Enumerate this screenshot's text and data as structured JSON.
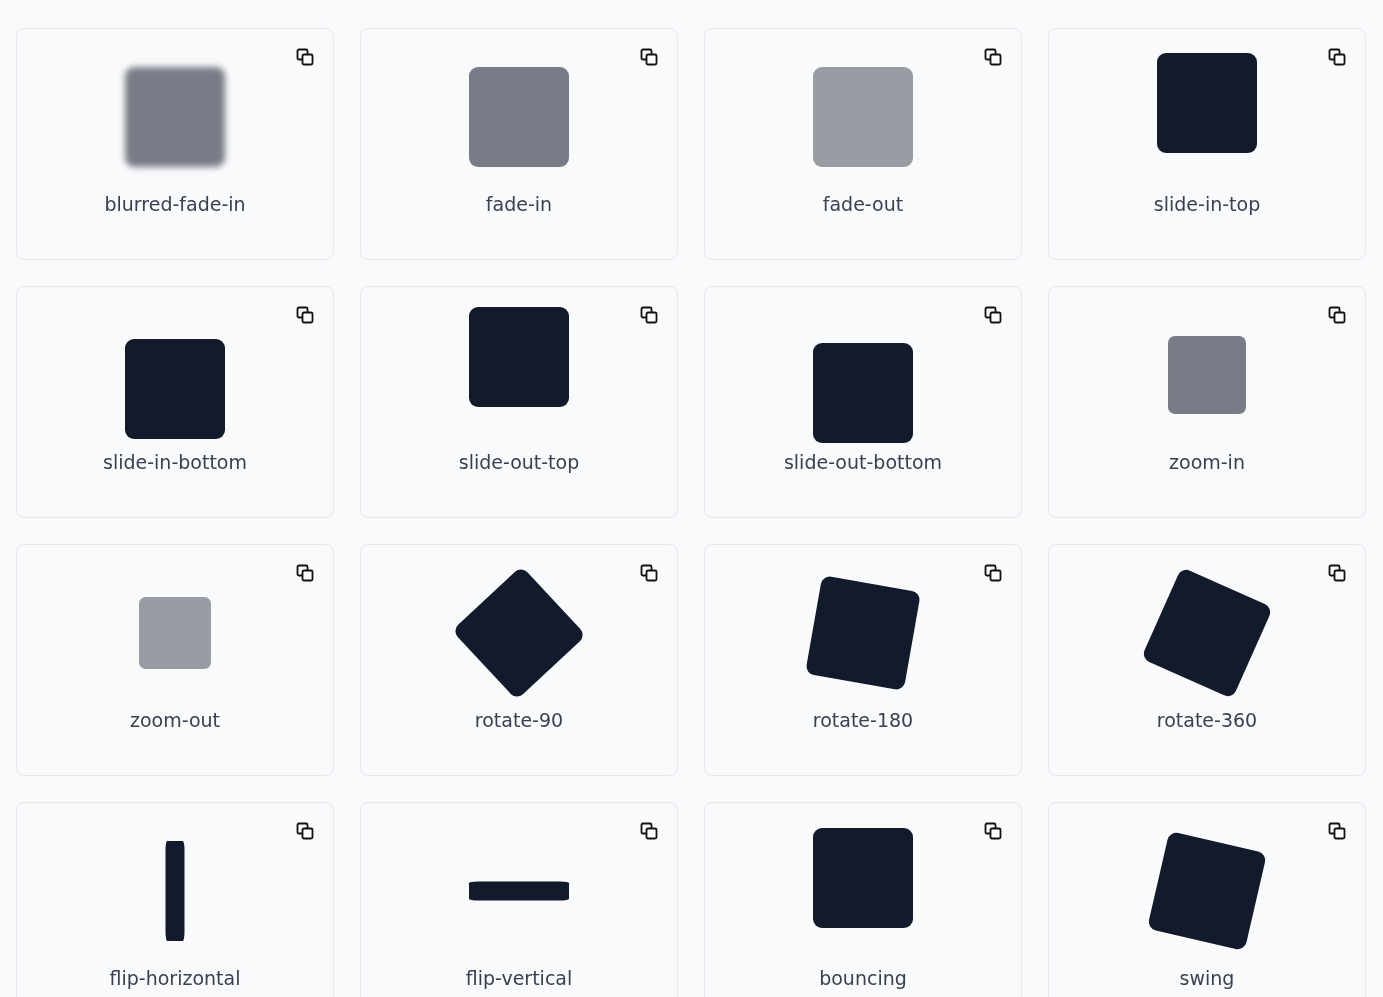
{
  "cards": [
    {
      "label": "blurred-fade-in",
      "kind": "blur"
    },
    {
      "label": "fade-in",
      "kind": "fade"
    },
    {
      "label": "fade-out",
      "kind": "faint"
    },
    {
      "label": "slide-in-top",
      "kind": "up"
    },
    {
      "label": "slide-in-bottom",
      "kind": "down"
    },
    {
      "label": "slide-out-top",
      "kind": "farup"
    },
    {
      "label": "slide-out-bottom",
      "kind": "fardown"
    },
    {
      "label": "zoom-in",
      "kind": "zoomed"
    },
    {
      "label": "zoom-out",
      "kind": "shrunk"
    },
    {
      "label": "rotate-90",
      "kind": "quarter"
    },
    {
      "label": "rotate-180",
      "kind": "tilt"
    },
    {
      "label": "rotate-360",
      "kind": "turn"
    },
    {
      "label": "flip-horizontal",
      "kind": "squeezex"
    },
    {
      "label": "flip-vertical",
      "kind": "squeezey"
    },
    {
      "label": "bouncing",
      "kind": "bounce"
    },
    {
      "label": "swing",
      "kind": "swing"
    }
  ]
}
